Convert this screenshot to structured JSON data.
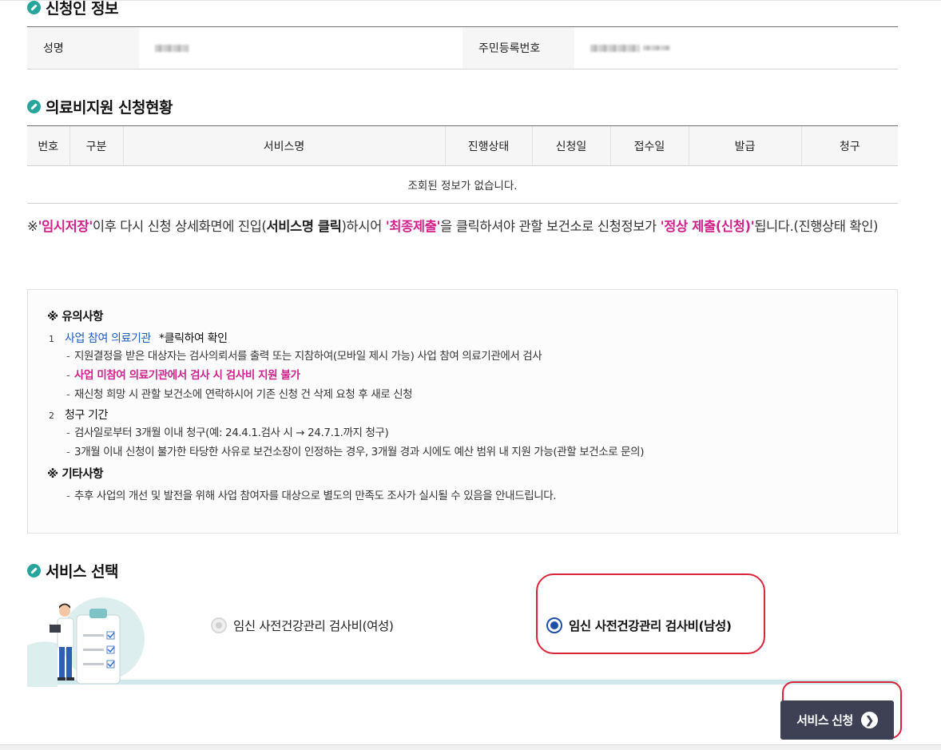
{
  "applicant": {
    "title": "신청인 정보",
    "name_label": "성명",
    "rrn_label": "주민등록번호"
  },
  "status": {
    "title": "의료비지원 신청현황",
    "columns": [
      "번호",
      "구분",
      "서비스명",
      "진행상태",
      "신청일",
      "접수일",
      "발급",
      "청구"
    ],
    "empty_message": "조회된 정보가 없습니다."
  },
  "instruction": {
    "prefix": "※",
    "temp_save": "'임시저장'",
    "part1": "이후 다시 신청 상세화면에 진입(",
    "service_click": "서비스명 클릭",
    "part2": ")하시어 ",
    "final_submit": "'최종제출'",
    "part3": "을 클릭하셔야 관할 보건소로 신청정보가 ",
    "normal_submit": "'정상 제출(신청)'",
    "part4": "됩니다.(진행상태 확인)"
  },
  "notice": {
    "heading": "※ 유의사항",
    "item1_num": "1",
    "item1_link": "사업 참여 의료기관",
    "item1_note": "*클릭하여 확인",
    "item1_sub1": "지원결정을 받은 대상자는 검사의뢰서를 출력 또는 지참하여(모바일 제시 가능) 사업 참여 의료기관에서 검사",
    "item1_sub2": "사업 미참여 의료기관에서 검사 시 검사비 지원 불가",
    "item1_sub3": "재신청 희망 시 관할 보건소에 연락하시어 기존 신청 건 삭제 요청 후 새로 신청",
    "item2_num": "2",
    "item2_title": "청구 기간",
    "item2_sub1": "검사일로부터 3개월 이내 청구(예: 24.4.1.검사 시 → 24.7.1.까지 청구)",
    "item2_sub2": "3개월 이내 신청이 불가한 타당한 사유로 보건소장이 인정하는 경우, 3개월 경과 시에도 예산 범위 내 지원 가능(관할 보건소로 문의)",
    "other_heading": "※ 기타사항",
    "other_sub1": "추후 사업의 개선 및 발전을 위해 사업 참여자를 대상으로 별도의 만족도 조사가 실시될 수 있음을 안내드립니다.",
    "dash": "-"
  },
  "service": {
    "title": "서비스 선택",
    "option_female": "임신 사전건강관리 검사비(여성)",
    "option_male": "임신 사전건강관리 검사비(남성)",
    "selected": "option_male"
  },
  "submit": {
    "label": "서비스 신청",
    "arrow_icon": "chevron-right-circle-icon"
  },
  "colors": {
    "accent_pink": "#d0218c",
    "accent_blue": "#1f5dbf",
    "radio_selected": "#1d4fa6",
    "button_bg": "#3d4153",
    "highlight_ring": "#d9253a",
    "title_icon": "#27a59c"
  }
}
